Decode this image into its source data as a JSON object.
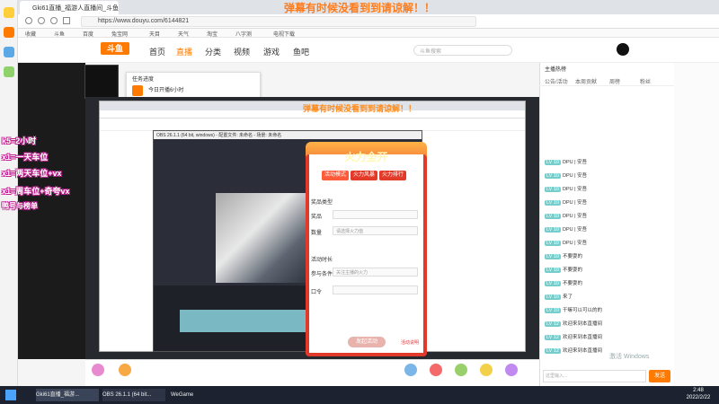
{
  "browser": {
    "tab_title": "Gki61直播_福游人直播间_斗鱼...",
    "url": "https://www.douyu.com/6144821",
    "bookmarks": [
      "收藏",
      "斗鱼",
      "百度",
      "兔宝网",
      "天目",
      "天气",
      "淘宝",
      "八字测",
      "电视下载"
    ]
  },
  "site": {
    "logo": "斗鱼",
    "nav": [
      "首页",
      "直播",
      "分类",
      "视频",
      "游戏",
      "鱼吧"
    ],
    "search_placeholder": "斗鱼搜索",
    "popup_title": "任务进度",
    "popup_text": "今日开播6小时"
  },
  "overlay": {
    "banner": "弹幕有时候没看到到请谅解！！",
    "inner_banner": "弹幕有时候没看到到请谅解！！",
    "lines": [
      "k5=2小时",
      "x1=一天车位",
      "x1=两天车位+vx",
      "x1=周车位+奇夸vx"
    ],
    "sticker": "鸭号与榜单"
  },
  "dialog": {
    "title": "火力全开",
    "tabs": [
      "活动模式",
      "火力风暴",
      "火力排行"
    ],
    "labels": [
      "奖品类型",
      "奖品",
      "数量",
      "活动时长",
      "参与条件",
      "口令"
    ],
    "fields": [
      "",
      "",
      "请选择火力值",
      "关注主播的火力",
      "",
      ""
    ],
    "submit": "发起活动",
    "footer_link": "活动说明"
  },
  "obs": {
    "title": "OBS 26.1.1 (64 bit, windows) - 配置文件: 未命名 - 场景: 未命名"
  },
  "chat": {
    "header": "主播热榜",
    "tabs": [
      "公告/活动",
      "本周贡献",
      "周榜",
      "粉丝"
    ],
    "lines": [
      {
        "lvl": "LV 10",
        "name": "",
        "msg": "DPU | 安吾"
      },
      {
        "lvl": "LV 10",
        "name": "",
        "msg": "DPU | 安吾"
      },
      {
        "lvl": "LV 10",
        "name": "",
        "msg": "DPU | 安吾"
      },
      {
        "lvl": "LV 10",
        "name": "",
        "msg": "DPU | 安吾"
      },
      {
        "lvl": "LV 10",
        "name": "",
        "msg": "DPU | 安吾"
      },
      {
        "lvl": "LV 10",
        "name": "",
        "msg": "DPU | 安吾"
      },
      {
        "lvl": "LV 10",
        "name": "",
        "msg": "DPU | 安吾"
      },
      {
        "lvl": "LV 10",
        "name": "",
        "msg": "不要耍的"
      },
      {
        "lvl": "LV 10",
        "name": "",
        "msg": "不要耍的"
      },
      {
        "lvl": "LV 10",
        "name": "",
        "msg": "不要耍的"
      },
      {
        "lvl": "LV 10",
        "name": "",
        "msg": "来了"
      },
      {
        "lvl": "LV 10",
        "name": "",
        "msg": "干嘛可以可以的的"
      },
      {
        "lvl": "LV 12",
        "name": "",
        "msg": "欢迎来到本直播间"
      },
      {
        "lvl": "LV 12",
        "name": "",
        "msg": "欢迎来到本直播间"
      },
      {
        "lvl": "LV 12",
        "name": "",
        "msg": "欢迎来到本直播间"
      }
    ],
    "input_placeholder": "这里输入...",
    "send": "发送"
  },
  "taskbar": {
    "items": [
      "Gki61直播_福游...",
      "OBS 26.1.1 (64 bit...",
      "WeGame"
    ],
    "time": "2:48",
    "date": "2022/2/22"
  },
  "watermark": "激活 Windows"
}
